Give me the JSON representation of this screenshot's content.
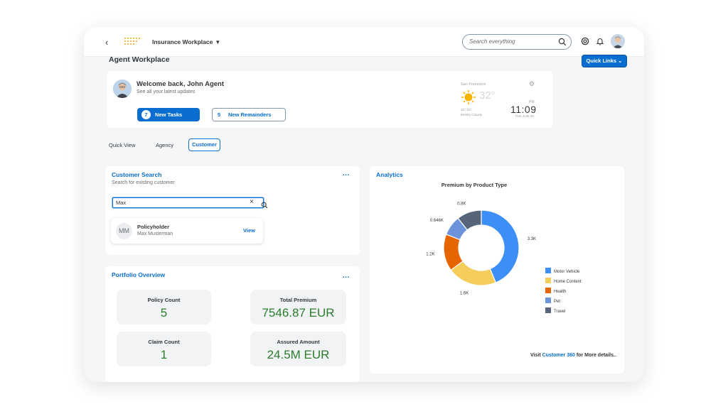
{
  "shell": {
    "back_glyph": "‹",
    "app_title": "Insurance Workplace",
    "search_placeholder": "Search everything",
    "icons": [
      "back-icon",
      "sap-logo",
      "caret-down-icon",
      "search-icon",
      "copilot-icon",
      "notification-bell-icon",
      "user-avatar"
    ]
  },
  "page": {
    "title": "Agent Workplace",
    "quick_links": "Quick Links ⌄"
  },
  "welcome": {
    "title": "Welcome back, John Agent",
    "subtitle": "See all your latest updates",
    "tasks_count": "7",
    "tasks_label": "New Tasks",
    "reminders_count": "5",
    "reminders_label": "New Remainders"
  },
  "weather": {
    "city": "San Francisco",
    "temperature": "32°",
    "hi_lo": "32° 22°",
    "condition": "Mostly Cloudy",
    "ampm": "PM",
    "time": "11:09",
    "date": "TUE JUN 10"
  },
  "tabs": [
    {
      "label": "Quick View"
    },
    {
      "label": "Agency"
    },
    {
      "label": "Customer",
      "selected": true
    }
  ],
  "customer_search": {
    "title": "Customer Search",
    "subtitle": "Search for existing customer",
    "more": "...",
    "input_value": "Max",
    "result": {
      "initials": "MM",
      "title": "Policyholder",
      "name": "Max Musterman",
      "action": "View"
    }
  },
  "portfolio": {
    "title": "Portfolio Overview",
    "more": "...",
    "tiles": [
      {
        "label": "Policy Count",
        "value": "5"
      },
      {
        "label": "Total Premium",
        "value": "7546.87 EUR"
      },
      {
        "label": "Claim Count",
        "value": "1"
      },
      {
        "label": "Assured Amount",
        "value": "24.5M EUR"
      }
    ]
  },
  "analytics": {
    "title": "Analytics",
    "footer_prefix": "Visit ",
    "footer_link": "Customer 360",
    "footer_suffix": " for More details.."
  },
  "chart_data": {
    "type": "pie",
    "donut": true,
    "title": "Premium by Product Type",
    "categories": [
      "Motor Vehicle",
      "Home Content",
      "Health",
      "Pet",
      "Travel"
    ],
    "values": [
      3300,
      1600,
      1200,
      646,
      800
    ],
    "labels": [
      "3.3K",
      "1.6K",
      "1.2K",
      "0.646K",
      "0.8K"
    ],
    "colors": [
      "#3d8ef7",
      "#f4cd5a",
      "#e76500",
      "#6a93dc",
      "#56657a"
    ],
    "legend_position": "right"
  }
}
